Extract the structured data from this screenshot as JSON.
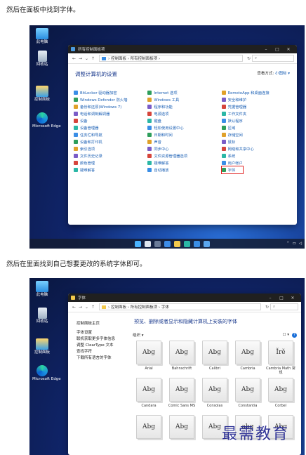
{
  "captions": {
    "step1": "然后在面板中找到字体。",
    "step2": "然后在里面找到自己想要更改的系统字体即可。"
  },
  "desktop": {
    "icons": [
      "此电脑",
      "回收站",
      "控制面板",
      "Microsoft Edge"
    ]
  },
  "control_panel": {
    "window_title": "所有控制面板项",
    "address_path": "› 控制面板 › 所有控制面板项 ›",
    "heading": "调整计算机的设置",
    "view_by_label": "查看方式:",
    "view_by_value": "小图标 ▾",
    "columns": [
      [
        "BitLocker 驱动器加密",
        "Windows Defender 防火墙",
        "备份和还原(Windows 7)",
        "电话和调制解调器",
        "设备",
        "设备管理器",
        "任务栏和导航",
        "设备和打印机",
        "索引选项",
        "文件历史记录",
        "颜色管理",
        "疑难解答"
      ],
      [
        "Internet 选项",
        "Windows 工具",
        "程序和功能",
        "电源选项",
        "键盘",
        "轻松使用设置中心",
        "日期和时间",
        "声音",
        "同步中心",
        "文件资源管理器选项",
        "疑难解答",
        "自动播放"
      ],
      [
        "RemoteApp 和桌面连接",
        "安全和维护",
        "凭据管理器",
        "工作文件夹",
        "默认程序",
        "区域",
        "存储空间",
        "鼠标",
        "网络和共享中心",
        "系统",
        "用户帐户",
        "字体"
      ]
    ],
    "highlighted": "字体"
  },
  "fonts_window": {
    "window_title": "字体",
    "address_path": "› 控制面板 › 所有控制面板项 › 字体",
    "sidebar": [
      "控制面板主页",
      "字体设置",
      "联机获取更多字体信息",
      "调整 ClearType 文本",
      "查找字符",
      "下载所有语言的字体"
    ],
    "heading": "预览、删除或者显示和隐藏计算机上安装的字体",
    "organize": "组织 ▾",
    "fonts": [
      {
        "sample": "Abg",
        "name": "Arial"
      },
      {
        "sample": "Abg",
        "name": "Bahnschrift"
      },
      {
        "sample": "Abg",
        "name": "Calibri"
      },
      {
        "sample": "Abg",
        "name": "Cambria"
      },
      {
        "sample": "Ĭrĕ",
        "name": "Cambria Math 常规"
      },
      {
        "sample": "Abg",
        "name": "Candara"
      },
      {
        "sample": "Abg",
        "name": "Comic Sans MS"
      },
      {
        "sample": "Abg",
        "name": "Consolas"
      },
      {
        "sample": "Abg",
        "name": "Constantia"
      },
      {
        "sample": "Abg",
        "name": "Corbel"
      },
      {
        "sample": "Abg",
        "name": ""
      },
      {
        "sample": "Abg",
        "name": ""
      },
      {
        "sample": "Abg",
        "name": ""
      },
      {
        "sample": "abg",
        "name": ""
      },
      {
        "sample": "Abg",
        "name": ""
      }
    ]
  },
  "watermark": "最需教育",
  "colors": {
    "link_blue": "#1a5fb4",
    "heading_blue": "#1e3d8f",
    "highlight_red": "#e02020"
  }
}
